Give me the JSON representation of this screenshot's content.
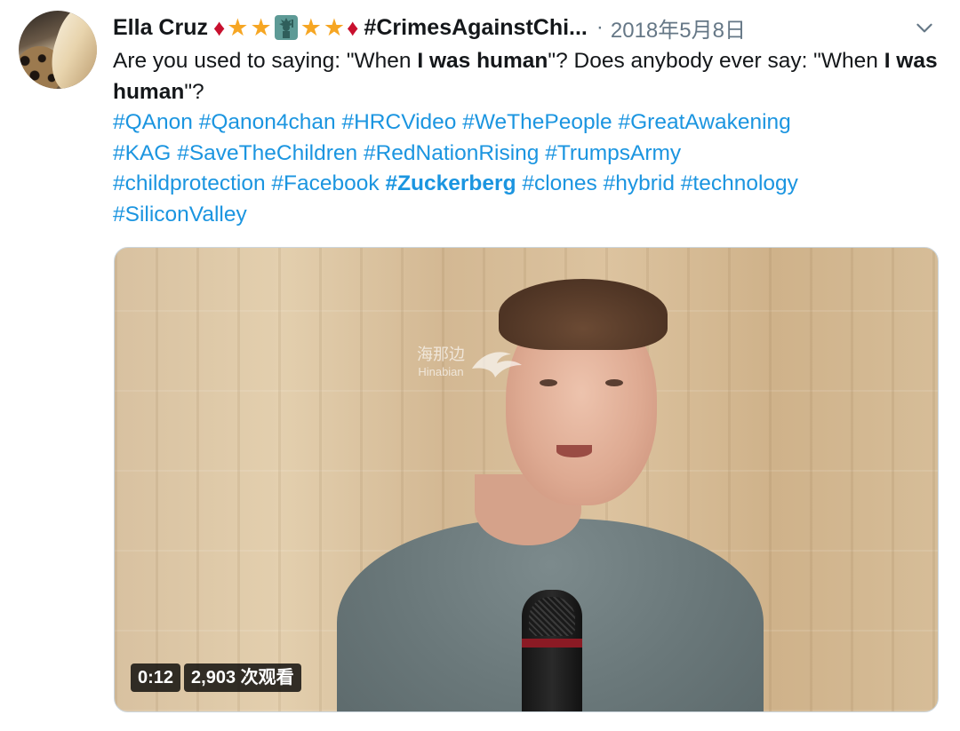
{
  "tweet": {
    "author_name": "Ella Cruz",
    "author_handle": "#CrimesAgainstChi...",
    "separator": "·",
    "date": "2018年5月8日",
    "text": {
      "part1": "Are you used to saying: \"When ",
      "bold1": "I was human",
      "part2": "\"? Does anybody ever say: \"When ",
      "bold2": "I was human",
      "part3": "\"?"
    },
    "hashtags": [
      "#QAnon",
      "#Qanon4chan",
      "#HRCVideo",
      "#WeThePeople",
      "#GreatAwakening",
      "#KAG",
      "#SaveTheChildren",
      "#RedNationRising",
      "#TrumpsArmy",
      "#childprotection",
      "#Facebook",
      "#Zuckerberg",
      "#clones",
      "#hybrid",
      "#technology",
      "#SiliconValley"
    ],
    "emoji": {
      "diamond": "♦",
      "star": "★"
    }
  },
  "media": {
    "duration": "0:12",
    "views": "2,903 次观看",
    "watermark_cn": "海那边",
    "watermark_en": "Hinabian"
  },
  "colors": {
    "link": "#1b95e0",
    "text": "#14171a",
    "meta": "#657786",
    "diamond": "#c8102e",
    "star": "#f6a623"
  },
  "icons": [
    "chevron-down-icon",
    "statue-of-liberty-icon"
  ]
}
